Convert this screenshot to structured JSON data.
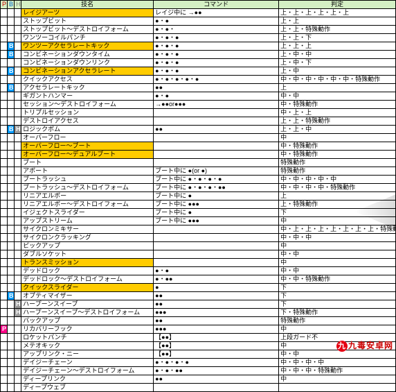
{
  "headers": {
    "p": "P",
    "b": "B",
    "h": "H",
    "name": "技名",
    "cmd": "コマンド",
    "hit": "判定"
  },
  "rows": [
    {
      "p": "",
      "b": "",
      "h": "",
      "name": "レイジアーツ",
      "cmd": "レイジ中に →●●",
      "hit": "上・上・上・上・上・上",
      "hl": true
    },
    {
      "p": "",
      "b": "",
      "h": "",
      "name": "ストップビット",
      "cmd": "●・●",
      "hit": "上・上"
    },
    {
      "p": "",
      "b": "",
      "h": "",
      "name": "ストップビット～デストロイフォーム",
      "cmd": "●・●・",
      "hit": "上・上・特殊動作"
    },
    {
      "p": "",
      "b": "",
      "h": "",
      "name": "ワンツーコイルパンチ",
      "cmd": "●・●・●",
      "hit": "上・上・下"
    },
    {
      "p": "",
      "b": "B",
      "h": "",
      "name": "ワンツーアクセラレートキック",
      "cmd": "●・●・●",
      "hit": "上・上・上",
      "hl": true
    },
    {
      "p": "",
      "b": "B",
      "h": "",
      "name": "コンビネーションダウンタイム",
      "cmd": "●・●・●",
      "hit": "上・中・中"
    },
    {
      "p": "",
      "b": "",
      "h": "",
      "name": "コンビネーションダウンリンク",
      "cmd": "●・●・●",
      "hit": "上・中・下"
    },
    {
      "p": "",
      "b": "B",
      "h": "",
      "name": "コンビネーションアクセラレート",
      "cmd": "●・●・●",
      "hit": "上・中",
      "hl": true
    },
    {
      "p": "",
      "b": "",
      "h": "",
      "name": "クイックアクセス",
      "cmd": "●・●・●・●・●",
      "hit": "中・中・中・中・中・中・特殊動作"
    },
    {
      "p": "",
      "b": "B",
      "h": "",
      "name": "アクセラレートキック",
      "cmd": "●●",
      "hit": "上"
    },
    {
      "p": "",
      "b": "",
      "h": "",
      "name": "ギガントハンマー",
      "cmd": "●・●",
      "hit": "中・中"
    },
    {
      "p": "",
      "b": "",
      "h": "",
      "name": "セッション～デストロイフォーム",
      "cmd": "→●●or●●●",
      "hit": "中・特殊動作"
    },
    {
      "p": "",
      "b": "",
      "h": "",
      "name": "トリプルセッション",
      "cmd": "",
      "hit": "中・上・上"
    },
    {
      "p": "",
      "b": "",
      "h": "",
      "name": "デストロイアクセス",
      "cmd": "",
      "hit": "上・上・特殊動作"
    },
    {
      "p": "",
      "b": "B",
      "h": "H",
      "name": "ロジックボム",
      "cmd": "●●",
      "hit": "上・上・中"
    },
    {
      "p": "",
      "b": "",
      "h": "",
      "name": "オーバーフロー",
      "cmd": "",
      "hit": "中"
    },
    {
      "p": "",
      "b": "",
      "h": "",
      "name": "オーバーフロー～ブート",
      "cmd": "",
      "hit": "中・特殊動作",
      "hl": true
    },
    {
      "p": "",
      "b": "",
      "h": "",
      "name": "オーバーフロー～デュアルブート",
      "cmd": "",
      "hit": "中・特殊動作",
      "hl": true
    },
    {
      "p": "",
      "b": "",
      "h": "",
      "name": "ブート",
      "cmd": "",
      "hit": "特殊動作"
    },
    {
      "p": "",
      "b": "",
      "h": "",
      "name": "アボート",
      "cmd": "ブート中に ●(or ●)",
      "hit": "特殊動作"
    },
    {
      "p": "",
      "b": "",
      "h": "",
      "name": "ブートラッシュ",
      "cmd": "ブート中に ●・●・●・●",
      "hit": "中・中・中・中・中"
    },
    {
      "p": "",
      "b": "",
      "h": "",
      "name": "ブートラッシュ～デストロイフォーム",
      "cmd": "ブート中に ●・●・●・●●",
      "hit": "中・中・中・中・特殊動作"
    },
    {
      "p": "",
      "b": "",
      "h": "",
      "name": "リニアエルボー",
      "cmd": "ブート中に ●",
      "hit": "上"
    },
    {
      "p": "",
      "b": "",
      "h": "",
      "name": "リニアエルボー～デストロイフォーム",
      "cmd": "ブート中に ●●●",
      "hit": "上・特殊動作"
    },
    {
      "p": "",
      "b": "",
      "h": "",
      "name": "イジェクトスライダー",
      "cmd": "ブート中に ●",
      "hit": "下"
    },
    {
      "p": "",
      "b": "",
      "h": "",
      "name": "アップストリーム",
      "cmd": "ブート中に ●●●",
      "hit": "中"
    },
    {
      "p": "",
      "b": "",
      "h": "",
      "name": "サイクロンミキサー",
      "cmd": "",
      "hit": "中・上・上・上・上・上・上・上・特殊動作"
    },
    {
      "p": "",
      "b": "",
      "h": "",
      "name": "サイクロンクラッキング",
      "cmd": "",
      "hit": "中・中・中"
    },
    {
      "p": "",
      "b": "",
      "h": "",
      "name": "ピックアップ",
      "cmd": "",
      "hit": "中"
    },
    {
      "p": "",
      "b": "",
      "h": "",
      "name": "ダブルソケット",
      "cmd": "",
      "hit": "中・中"
    },
    {
      "p": "",
      "b": "",
      "h": "",
      "name": "トランスミッション",
      "cmd": "",
      "hit": "中",
      "hl": true
    },
    {
      "p": "",
      "b": "",
      "h": "",
      "name": "デッドロック",
      "cmd": "●・●",
      "hit": "中・中"
    },
    {
      "p": "",
      "b": "",
      "h": "",
      "name": "デッドロック～デストロイフォーム",
      "cmd": "●・●●",
      "hit": "中・中・特殊動作"
    },
    {
      "p": "",
      "b": "",
      "h": "",
      "name": "クイックスライダー",
      "cmd": "●",
      "hit": "下",
      "hl": true
    },
    {
      "p": "",
      "b": "B",
      "h": "",
      "name": "オプティマイザー",
      "cmd": "●●",
      "hit": "下"
    },
    {
      "p": "",
      "b": "",
      "h": "H",
      "name": "ハープーンスイープ",
      "cmd": "●●",
      "hit": "下"
    },
    {
      "p": "",
      "b": "",
      "h": "H",
      "name": "ハープーンスイープ～デストロイフォーム",
      "cmd": "●●●",
      "hit": "下・特殊動作"
    },
    {
      "p": "",
      "b": "",
      "h": "",
      "name": "バックアップ",
      "cmd": "●●",
      "hit": "特殊動作"
    },
    {
      "p": "P",
      "b": "",
      "h": "",
      "name": "リカバリーフック",
      "cmd": "●●●",
      "hit": "中"
    },
    {
      "p": "",
      "b": "",
      "h": "",
      "name": "ロケットパンチ",
      "cmd": "【●●】",
      "hit": "上段ガード不"
    },
    {
      "p": "",
      "b": "",
      "h": "",
      "name": "メテオキック",
      "cmd": "【●●】",
      "hit": "中"
    },
    {
      "p": "",
      "b": "",
      "h": "",
      "name": "アップリンク・ニー",
      "cmd": "【●●】",
      "hit": "中・中"
    },
    {
      "p": "",
      "b": "",
      "h": "",
      "name": "デイジーチェーン",
      "cmd": "●・●・●・●",
      "hit": "中・中・中・中"
    },
    {
      "p": "",
      "b": "",
      "h": "",
      "name": "デイジーチェーン～デストロイフォーム",
      "cmd": "●・●・●●",
      "hit": "中・中・中・特殊動作"
    },
    {
      "p": "",
      "b": "",
      "h": "",
      "name": "ディープリンク",
      "cmd": "●●",
      "hit": "中"
    },
    {
      "p": "",
      "b": "",
      "h": "",
      "name": "ディープウェブ",
      "cmd": "",
      "hit": ""
    }
  ],
  "watermark": "九毒安卓网"
}
